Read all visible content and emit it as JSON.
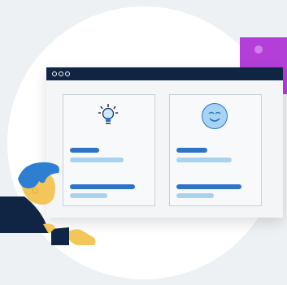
{
  "illustration": {
    "window": {
      "title_dots": [
        "dot-1",
        "dot-2",
        "dot-3"
      ],
      "cards": [
        {
          "icon": "lightbulb-icon"
        },
        {
          "icon": "smiley-face-icon"
        }
      ]
    },
    "colors": {
      "background": "#eef1f3",
      "titlebar": "#102544",
      "accent_purple": "#b33fd8",
      "dark_blue": "#2d73c6",
      "light_blue": "#a9d2ee",
      "face_fill": "#a8d4f3",
      "hair": "#2e7fd1",
      "skin": "#f3c65a"
    }
  }
}
